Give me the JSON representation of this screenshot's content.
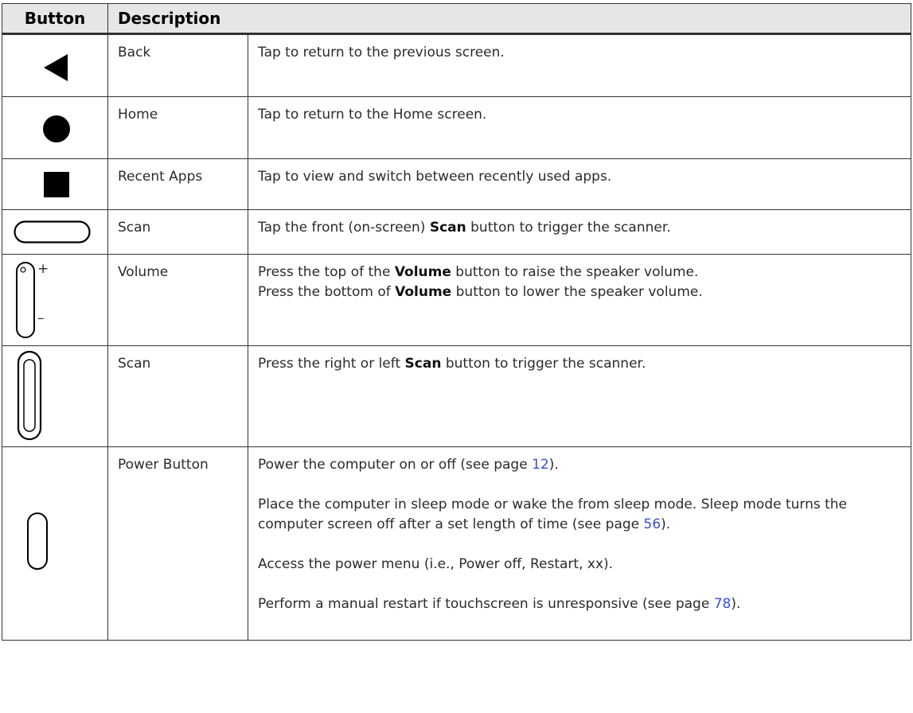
{
  "headers": {
    "button": "Button",
    "description": "Description"
  },
  "rows": [
    {
      "icon": "back-triangle-icon",
      "name": "Back",
      "desc": [
        "Tap to return to the previous screen."
      ]
    },
    {
      "icon": "home-circle-icon",
      "name": "Home",
      "desc": [
        "Tap to return to the Home screen."
      ]
    },
    {
      "icon": "recent-apps-square-icon",
      "name": "Recent Apps",
      "desc": [
        "Tap to view and switch between recently used apps."
      ]
    },
    {
      "icon": "scan-pill-icon",
      "name": "Scan",
      "desc": {
        "pre": "Tap the front (on-screen) ",
        "bold": "Scan",
        "post": " button to trigger the scanner."
      }
    },
    {
      "icon": "volume-rocker-icon",
      "name": "Volume",
      "line1": {
        "pre": "Press the top of the ",
        "bold": "Volume",
        "post": " button to raise the speaker volume."
      },
      "line2": {
        "pre": "Press the bottom of ",
        "bold": "Volume",
        "post": " button to lower the speaker volume."
      },
      "plus": "+",
      "minus": "–"
    },
    {
      "icon": "side-scan-button-icon",
      "name": "Scan",
      "desc": {
        "pre": "Press the right or left ",
        "bold": "Scan",
        "post": " button to trigger the scanner."
      }
    },
    {
      "icon": "power-button-icon",
      "name": "Power Button",
      "p1": {
        "pre": "Power the computer on or off (see page ",
        "link": "12",
        "post": ")."
      },
      "p2": {
        "pre": "Place the computer in sleep mode or wake the from sleep mode. Sleep mode turns the computer screen off after a set length of time (see page ",
        "link": "56",
        "post": ")."
      },
      "p3": "Access the power menu (i.e., Power off, Restart, xx).",
      "p4": {
        "pre": "Perform a manual restart if touchscreen is unresponsive (see page ",
        "link": "78",
        "post": ")."
      }
    }
  ]
}
